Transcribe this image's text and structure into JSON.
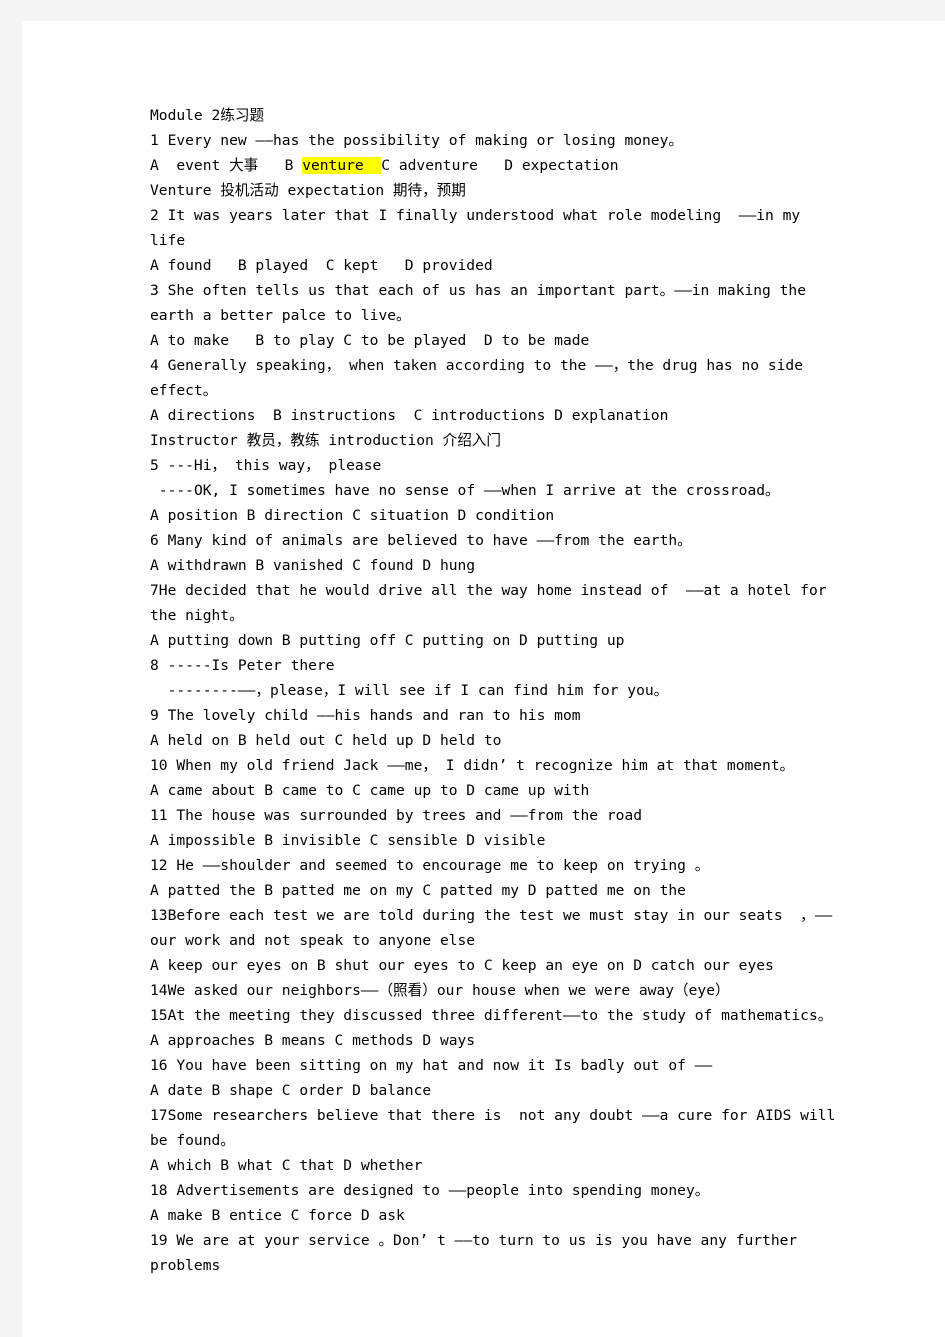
{
  "page": {
    "background_color": "#f4f4f4",
    "paper_color": "#ffffff",
    "text_color": "#000000",
    "highlight_color": "#ffff00"
  },
  "document": {
    "title": "Module 2练习题",
    "lines": [
      {
        "id": "title",
        "text": "Module 2练习题"
      },
      {
        "id": "q1",
        "text": "1 Every new ——has the possibility of making or losing money。"
      },
      {
        "id": "q1-opts-pre",
        "text": "A  event 大事   B ",
        "highlight": "venture  ",
        "post": "C adventure   D expectation"
      },
      {
        "id": "q1-note",
        "text": "Venture 投机活动 expectation 期待，预期"
      },
      {
        "id": "q2",
        "text": "2 It was years later that I finally understood what role modeling  ——in my life"
      },
      {
        "id": "q2-opts",
        "text": "A found   B played  C kept   D provided"
      },
      {
        "id": "q3",
        "text": "3 She often tells us that each of us has an important part。——in making the earth a better palce to live。"
      },
      {
        "id": "q3-opts",
        "text": "A to make   B to play C to be played  D to be made"
      },
      {
        "id": "q4",
        "text": "4 Generally speaking， when taken according to the ——，the drug has no side effect。"
      },
      {
        "id": "q4-opts",
        "text": "A directions  B instructions  C introductions D explanation"
      },
      {
        "id": "q4-note",
        "text": "Instructor 教员，教练 introduction 介绍入门"
      },
      {
        "id": "q5a",
        "text": "5 ---Hi， this way， please"
      },
      {
        "id": "q5b",
        "text": " ----OK, I sometimes have no sense of ——when I arrive at the crossroad。"
      },
      {
        "id": "q5-opts",
        "text": "A position B direction C situation D condition"
      },
      {
        "id": "q6",
        "text": "6 Many kind of animals are believed to have ——from the earth。"
      },
      {
        "id": "q6-opts",
        "text": "A withdrawn B vanished C found D hung"
      },
      {
        "id": "q7",
        "text": "7He decided that he would drive all the way home instead of  ——at a hotel for the night。"
      },
      {
        "id": "q7-opts",
        "text": "A putting down B putting off C putting on D putting up"
      },
      {
        "id": "q8a",
        "text": "8 -----Is Peter there"
      },
      {
        "id": "q8b",
        "text": "  --------——，please，I will see if I can find him for you。"
      },
      {
        "id": "q9",
        "text": "9 The lovely child ——his hands and ran to his mom"
      },
      {
        "id": "q9-opts",
        "text": "A held on B held out C held up D held to"
      },
      {
        "id": "q10",
        "text": "10 When my old friend Jack ——me， I didn’ t recognize him at that moment。"
      },
      {
        "id": "q10-opts",
        "text": "A came about B came to C came up to D came up with"
      },
      {
        "id": "q11",
        "text": "11 The house was surrounded by trees and ——from the road"
      },
      {
        "id": "q11-opts",
        "text": "A impossible B invisible C sensible D visible"
      },
      {
        "id": "q12",
        "text": "12 He ——shoulder and seemed to encourage me to keep on trying 。"
      },
      {
        "id": "q12-opts",
        "text": "A patted the B patted me on my C patted my D patted me on the"
      },
      {
        "id": "q13",
        "text": "13Before each test we are told during the test we must stay in our seats  ，——our work and not speak to anyone else"
      },
      {
        "id": "q13-opts",
        "text": "A keep our eyes on B shut our eyes to C keep an eye on D catch our eyes"
      },
      {
        "id": "q14",
        "text": "14We asked our neighbors——（照看）our house when we were away（eye）"
      },
      {
        "id": "q15",
        "text": "15At the meeting they discussed three different——to the study of mathematics。"
      },
      {
        "id": "q15-opts",
        "text": "A approaches B means C methods D ways"
      },
      {
        "id": "q16",
        "text": "16 You have been sitting on my hat and now it Is badly out of ——"
      },
      {
        "id": "q16-opts",
        "text": "A date B shape C order D balance"
      },
      {
        "id": "q17",
        "text": "17Some researchers believe that there is  not any doubt ——a cure for AIDS will be found。"
      },
      {
        "id": "q17-opts",
        "text": "A which B what C that D whether"
      },
      {
        "id": "q18",
        "text": "18 Advertisements are designed to ——people into spending money。"
      },
      {
        "id": "q18-opts",
        "text": "A make B entice C force D ask"
      },
      {
        "id": "q19",
        "text": "19 We are at your service 。Don’ t ——to turn to us is you have any further problems"
      }
    ]
  }
}
